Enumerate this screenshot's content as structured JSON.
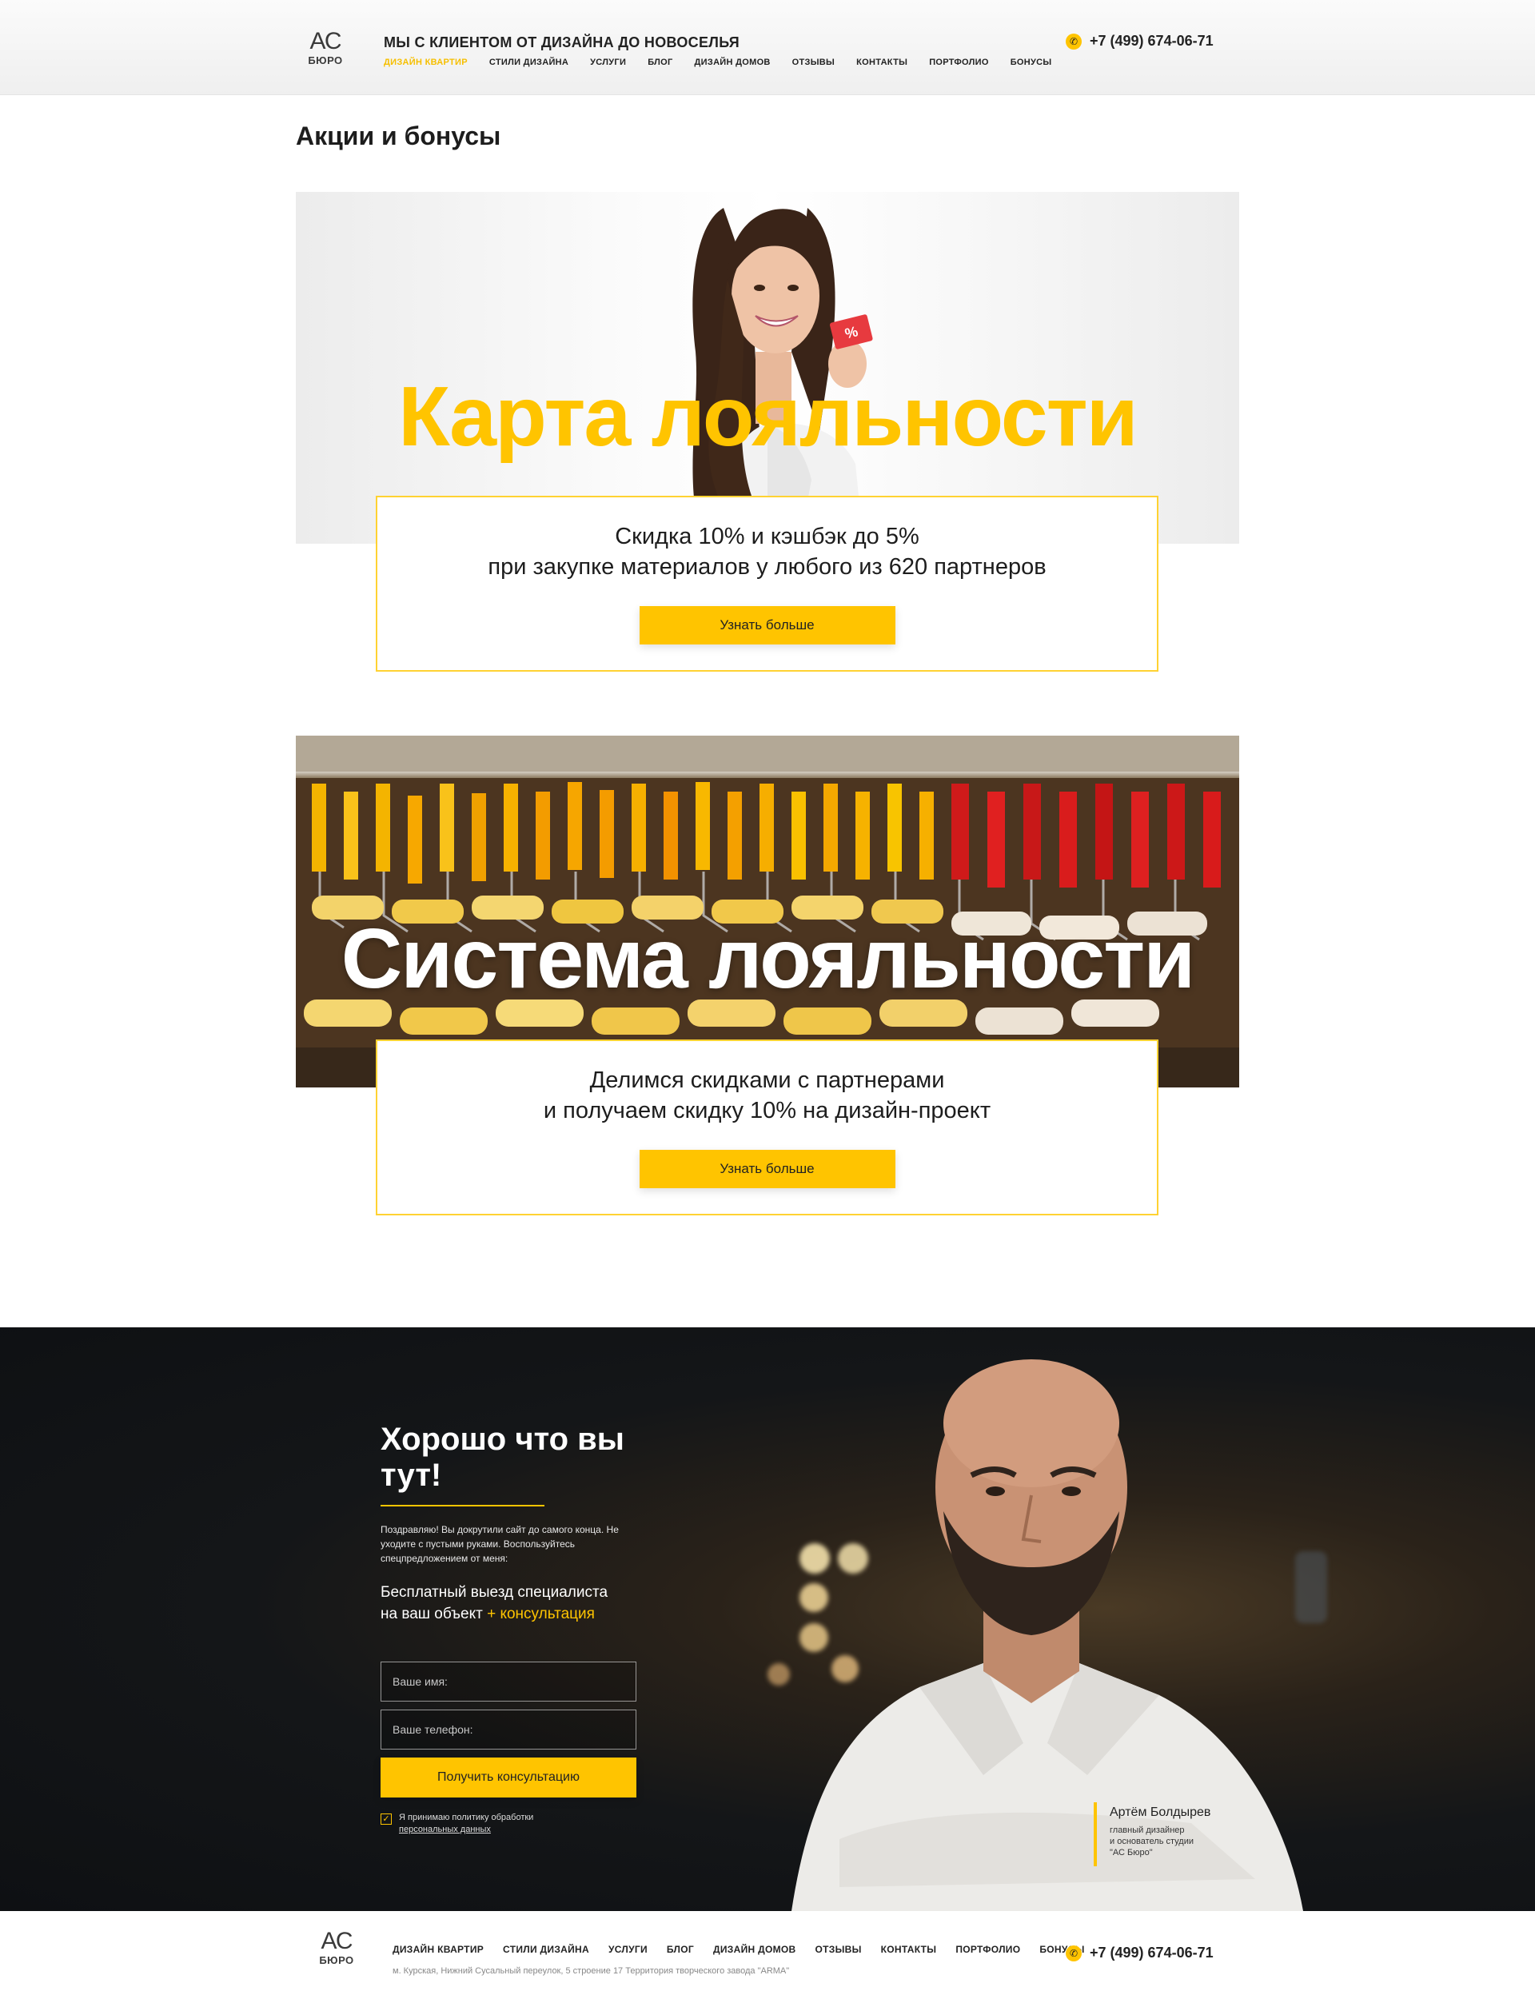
{
  "header": {
    "logo_top": "АС",
    "logo_bottom": "БЮРО",
    "tagline": "МЫ С КЛИЕНТОМ ОТ ДИЗАЙНА ДО НОВОСЕЛЬЯ",
    "nav": [
      "ДИЗАЙН КВАРТИР",
      "СТИЛИ ДИЗАЙНА",
      "УСЛУГИ",
      "БЛОГ",
      "ДИЗАЙН ДОМОВ",
      "ОТЗЫВЫ",
      "КОНТАКТЫ",
      "ПОРТФОЛИО",
      "БОНУСЫ"
    ],
    "active_nav": "ДИЗАЙН КВАРТИР",
    "phone": "+7 (499) 674-06-71",
    "phone_icon": "phone-icon"
  },
  "page": {
    "title": "Акции и бонусы"
  },
  "promo1": {
    "headline": "Карта лояльности",
    "line1": "Скидка 10% и кэшбэк до 5%",
    "line2": "при закупке материалов у любого из 620 партнеров",
    "button": "Узнать больше",
    "card_text": "%"
  },
  "promo2": {
    "headline": "Система лояльности",
    "line1": "Делимся скидками с партнерами",
    "line2": "и получаем скидку 10% на дизайн-проект",
    "button": "Узнать больше"
  },
  "cta": {
    "title": "Хорошо что вы тут!",
    "intro": "Поздравляю! Вы докрутили сайт до самого конца. Не уходите с пустыми руками. Воспользуйтесь спецпредложением от меня:",
    "offer_line1": "Бесплатный выезд специалиста",
    "offer_line2": "на ваш объект",
    "offer_accent": "+ консультация",
    "name_placeholder": "Ваше имя:",
    "phone_placeholder": "Ваше телефон:",
    "submit": "Получить консультацию",
    "consent_text": "Я принимаю политику обработки",
    "consent_link": "персональных данных"
  },
  "signature": {
    "name": "Артём Болдырев",
    "role_line1": "главный дизайнер",
    "role_line2": "и основатель студии",
    "role_line3": "\"АС Бюро\""
  },
  "footer": {
    "logo_top": "АС",
    "logo_bottom": "БЮРО",
    "nav": [
      "ДИЗАЙН КВАРТИР",
      "СТИЛИ ДИЗАЙНА",
      "УСЛУГИ",
      "БЛОГ",
      "ДИЗАЙН ДОМОВ",
      "ОТЗЫВЫ",
      "КОНТАКТЫ",
      "ПОРТФОЛИО",
      "БОНУСЫ"
    ],
    "address": "м. Курская, Нижний Сусальный переулок, 5 строение 17   Территория творческого завода \"ARMA\"",
    "phone": "+7 (499) 674-06-71"
  },
  "colors": {
    "accent": "#ffc400",
    "dark_bg": "#141618",
    "text": "#1d1d1d"
  }
}
